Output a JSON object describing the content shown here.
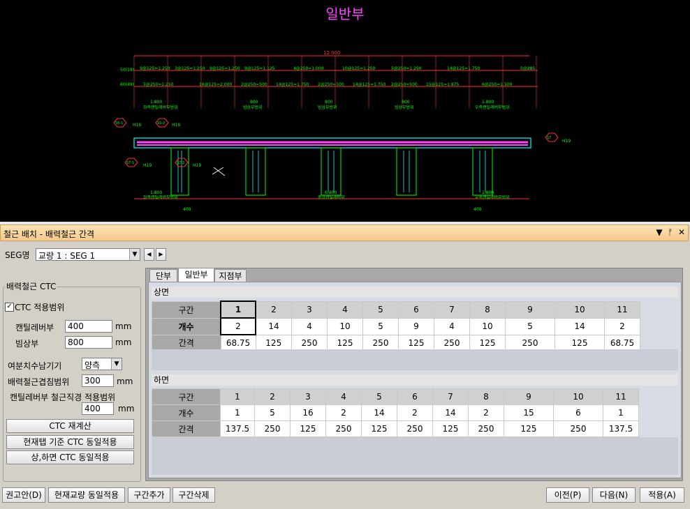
{
  "cad": {
    "title": "일반부",
    "dim_total": "12.000",
    "row1_left": "50(19)",
    "row1_items": [
      "9@125=1.250",
      "3@125=1.250",
      "9@125=1.250",
      "9@125=1.125",
      "4@250=1.000",
      "10@125=1.250",
      "5@250=1.250",
      "14@125=1.750",
      "0@285"
    ],
    "row2_left": "60(49)",
    "row2_items": [
      "5@250=1.250",
      "16@125=2.000",
      "2@250=500",
      "14@125=1.750",
      "2@250=500",
      "14@125=1.750",
      "2@250=500",
      "15@125=1.875",
      "6@250=1.500"
    ],
    "top_labels": [
      "좌측캔틸레버부범위",
      "빔상부범위",
      "빔상부범위",
      "빔상부범위",
      "우측캔틸레버부범위"
    ],
    "top_dims": [
      "1.800",
      "800",
      "800",
      "800",
      "1.800"
    ],
    "bottom_labels": [
      "좌측캔틸레버부범위",
      "중앙캔틸레버부",
      "우측캔틸레버부범위"
    ],
    "bottom_dims": [
      "1.800",
      "6.400",
      "1.800"
    ],
    "small_dims": [
      "400",
      "400"
    ],
    "markers": [
      "S5-1",
      "S5-2",
      "S7-1",
      "S7-2",
      "S7"
    ],
    "bar_labels": [
      "H19",
      "H19",
      "H19",
      "H19",
      "H19"
    ],
    "colors": {
      "dim": "#ff3030",
      "text": "#00ff00",
      "deck": "#00ffff",
      "rebar": "#ff44ff",
      "pier": "#00ff00",
      "marker": "#ff3030"
    }
  },
  "panel": {
    "title": "철근 배치 - 배력철근 간격",
    "header_buttons": [
      "▼",
      "ᚠ",
      "✕"
    ]
  },
  "seg": {
    "label": "SEG명",
    "value": "교량 1 : SEG 1",
    "prev": "◀",
    "next": "▶"
  },
  "left": {
    "group_title": "배력철근 CTC",
    "ctc_range_label": "CTC 적용범위",
    "ctc_range_checked": true,
    "cantilever_label": "캔틸레버부",
    "cantilever_value": "400",
    "beam_label": "빔상부",
    "beam_value": "800",
    "unit": "mm",
    "remainder_label": "여분치수남기기",
    "remainder_value": "양측",
    "overlap_label": "배력철근겹침범위",
    "overlap_value": "300",
    "cant_dia_label": "캔틸레버부 철근직경 적용범위",
    "cant_dia_value": "400",
    "recalc_button": "CTC 재계산",
    "apply_tab_button": "현재탭 기준 CTC 동일적용",
    "apply_both_button": "상,하면 CTC 동일적용"
  },
  "tabs": [
    "단부",
    "일반부",
    "지점부"
  ],
  "active_tab": 1,
  "upper": {
    "label": "상면",
    "row_labels": [
      "구간",
      "개수",
      "간격"
    ],
    "sections": [
      "1",
      "2",
      "3",
      "4",
      "5",
      "6",
      "7",
      "8",
      "9",
      "10",
      "11"
    ],
    "counts": [
      "2",
      "14",
      "4",
      "10",
      "5",
      "9",
      "4",
      "10",
      "5",
      "14",
      "2"
    ],
    "spacings": [
      "68.75",
      "125",
      "250",
      "125",
      "250",
      "125",
      "250",
      "125",
      "250",
      "125",
      "68.75"
    ]
  },
  "lower": {
    "label": "하면",
    "row_labels": [
      "구간",
      "개수",
      "간격"
    ],
    "sections": [
      "1",
      "2",
      "3",
      "4",
      "5",
      "6",
      "7",
      "8",
      "9",
      "10",
      "11"
    ],
    "counts": [
      "1",
      "5",
      "16",
      "2",
      "14",
      "2",
      "14",
      "2",
      "15",
      "6",
      "1"
    ],
    "spacings": [
      "137.5",
      "250",
      "125",
      "250",
      "125",
      "250",
      "125",
      "250",
      "125",
      "250",
      "137.5"
    ]
  },
  "bottom_buttons": {
    "recommend": "권고안(D)",
    "same_bridge": "현재교량 동일적용",
    "add_section": "구간추가",
    "delete_section": "구간삭제",
    "prev": "이전(P)",
    "next": "다음(N)",
    "apply": "적용(A)"
  }
}
